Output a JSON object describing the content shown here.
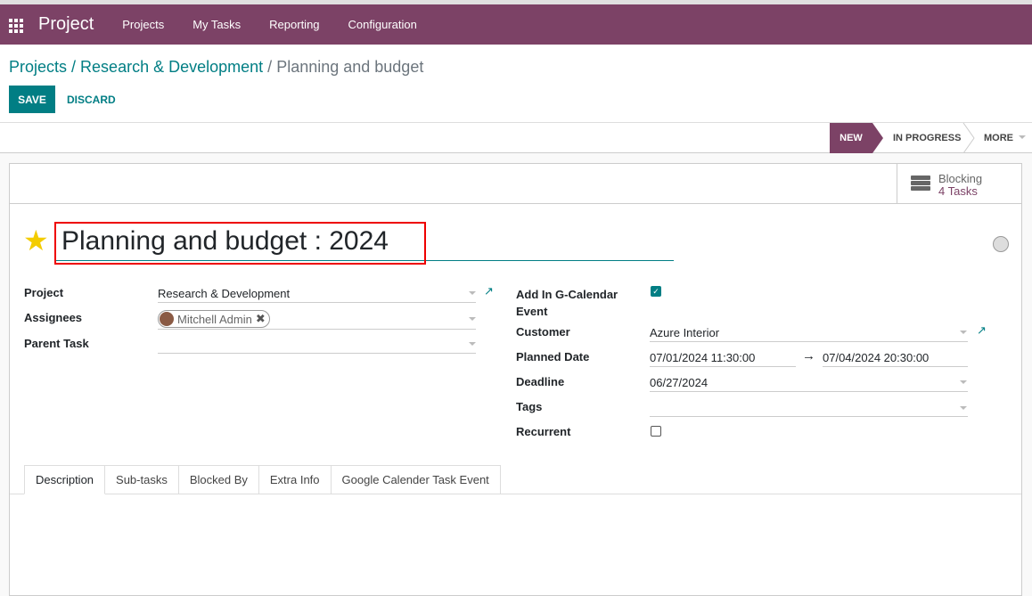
{
  "nav": {
    "app": "Project",
    "menu": [
      "Projects",
      "My Tasks",
      "Reporting",
      "Configuration"
    ]
  },
  "breadcrumb": {
    "items": [
      "Projects",
      "Research & Development"
    ],
    "current": "Planning and budget"
  },
  "actions": {
    "save": "SAVE",
    "discard": "DISCARD"
  },
  "stages": {
    "new": "NEW",
    "in_progress": "IN PROGRESS",
    "more": "MORE"
  },
  "smart_button": {
    "label": "Blocking",
    "value": "4 Tasks"
  },
  "task": {
    "title": "Planning and budget : 2024"
  },
  "fields": {
    "project": {
      "label": "Project",
      "value": "Research & Development"
    },
    "assignees": {
      "label": "Assignees",
      "value": "Mitchell Admin"
    },
    "parent": {
      "label": "Parent Task",
      "value": ""
    },
    "gcal": {
      "label": "Add In G-Calendar Event",
      "checked": true
    },
    "customer": {
      "label": "Customer",
      "value": "Azure Interior"
    },
    "planned": {
      "label": "Planned Date",
      "start": "07/01/2024 11:30:00",
      "end": "07/04/2024 20:30:00"
    },
    "deadline": {
      "label": "Deadline",
      "value": "06/27/2024"
    },
    "tags": {
      "label": "Tags",
      "value": ""
    },
    "recurrent": {
      "label": "Recurrent",
      "checked": false
    }
  },
  "tabs": [
    "Description",
    "Sub-tasks",
    "Blocked By",
    "Extra Info",
    "Google Calender Task Event"
  ]
}
